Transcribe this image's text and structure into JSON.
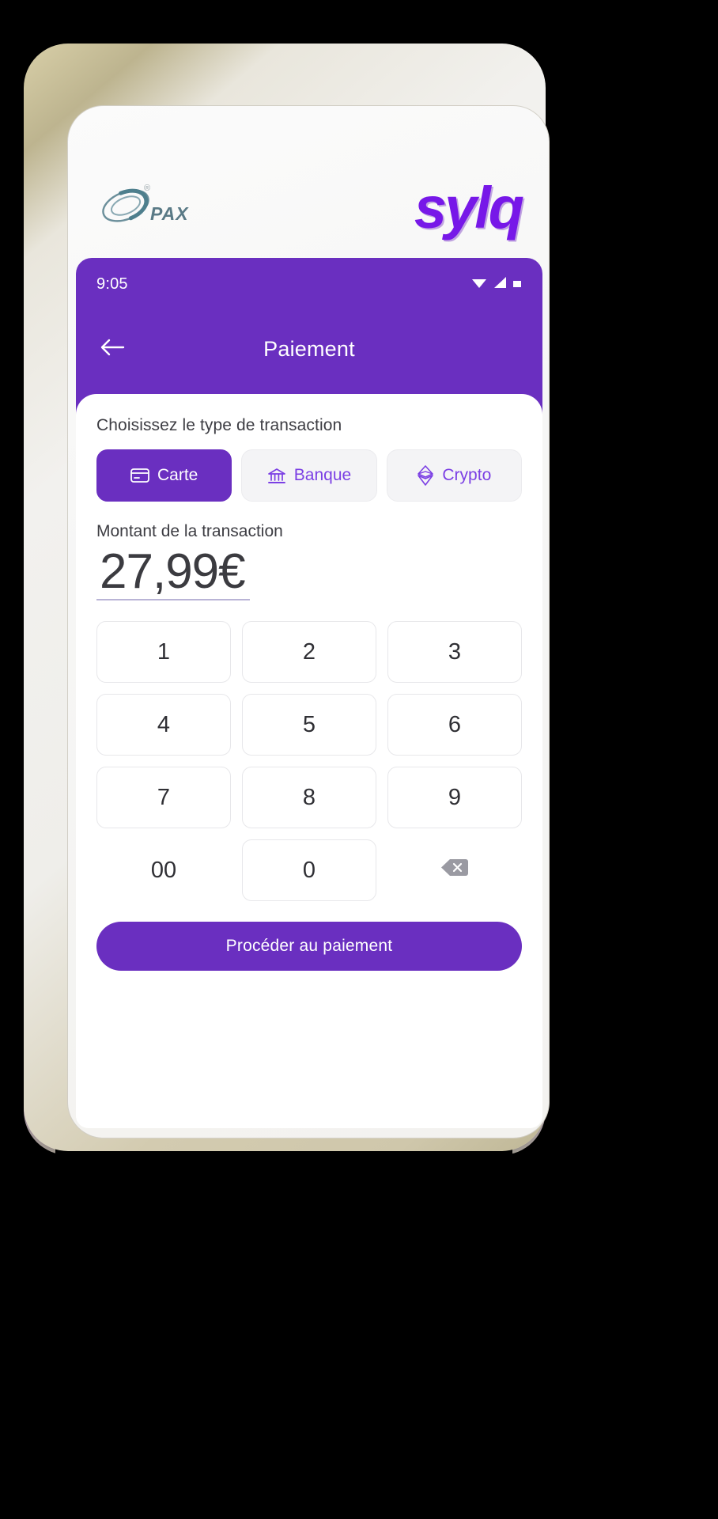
{
  "device": {
    "brand_logo_text": "PAX",
    "brand_logo_registered": "®",
    "app_brand": "sylq"
  },
  "statusbar": {
    "time": "9:05",
    "icons": [
      "wifi-icon",
      "signal-icon",
      "battery-icon"
    ]
  },
  "appbar": {
    "back_icon": "arrow-left-icon",
    "title": "Paiement"
  },
  "transaction_type": {
    "label": "Choisissez le type de transaction",
    "options": [
      {
        "label": "Carte",
        "icon": "credit-card-icon",
        "active": true
      },
      {
        "label": "Banque",
        "icon": "bank-icon",
        "active": false
      },
      {
        "label": "Crypto",
        "icon": "ethereum-icon",
        "active": false
      }
    ]
  },
  "amount": {
    "label": "Montant de la transaction",
    "value": "27,99€"
  },
  "keypad": {
    "keys": [
      {
        "label": "1",
        "type": "digit"
      },
      {
        "label": "2",
        "type": "digit"
      },
      {
        "label": "3",
        "type": "digit"
      },
      {
        "label": "4",
        "type": "digit"
      },
      {
        "label": "5",
        "type": "digit"
      },
      {
        "label": "6",
        "type": "digit"
      },
      {
        "label": "7",
        "type": "digit"
      },
      {
        "label": "8",
        "type": "digit"
      },
      {
        "label": "9",
        "type": "digit"
      },
      {
        "label": "00",
        "type": "double-zero"
      },
      {
        "label": "0",
        "type": "digit"
      },
      {
        "label": "",
        "type": "backspace",
        "icon": "backspace-icon"
      }
    ]
  },
  "cta": {
    "label": "Procéder au paiement"
  },
  "colors": {
    "primary": "#6a2fc0",
    "accent": "#7b3fe4",
    "brand_logo": "#7718e8",
    "key_border": "#e7e7ea",
    "tab_inactive_bg": "#f4f4f6"
  }
}
